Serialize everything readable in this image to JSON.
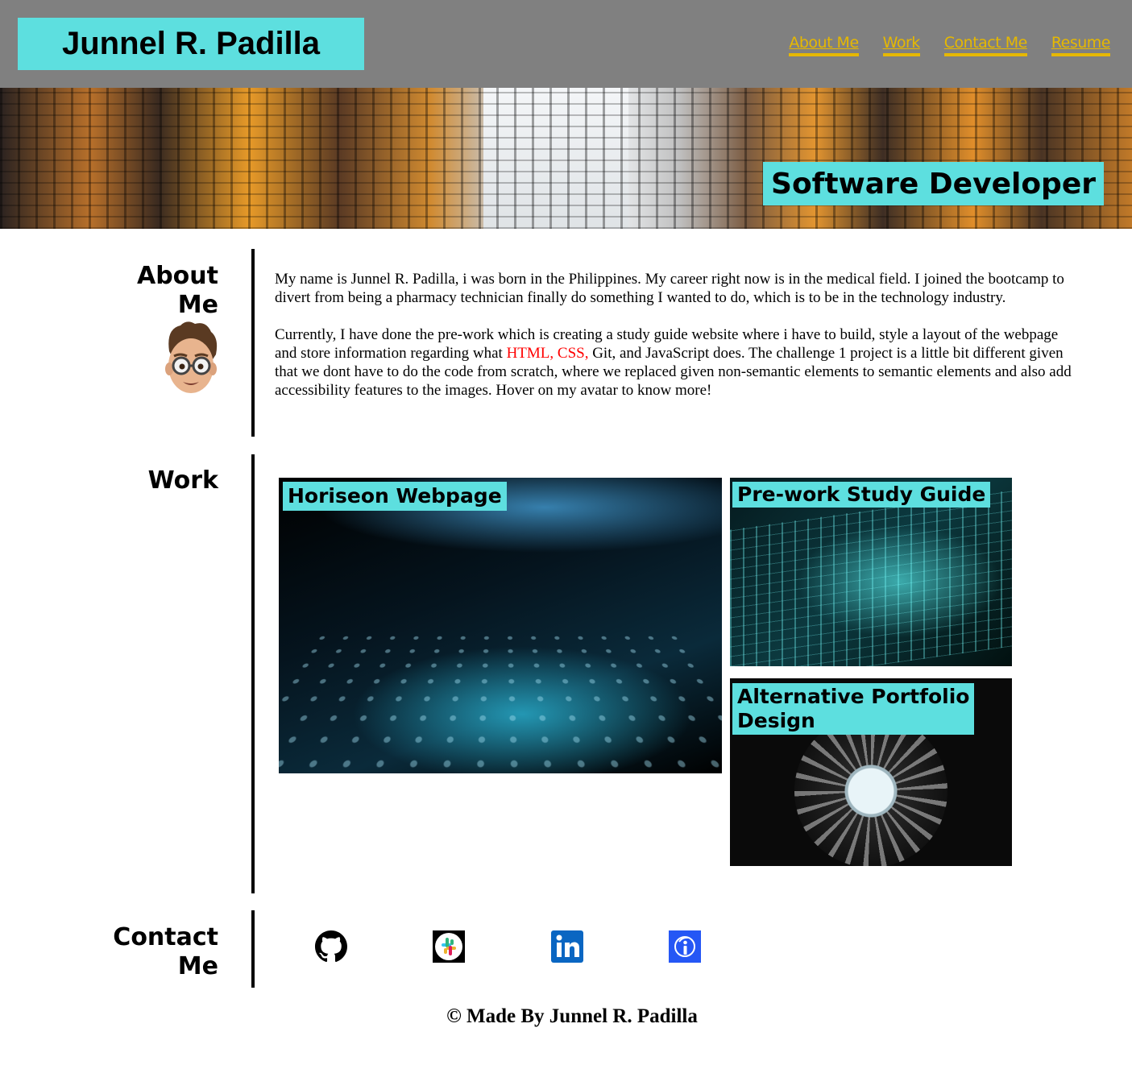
{
  "header": {
    "brand": "Junnel R. Padilla",
    "nav": [
      "About Me",
      "Work",
      "Contact Me",
      "Resume"
    ]
  },
  "hero": {
    "title": "Software Developer"
  },
  "about": {
    "label_line1": "About",
    "label_line2": "Me",
    "paragraph1": "My name is Junnel R. Padilla, i was born in the Philippines. My career right now is in the medical field. I joined the bootcamp to divert from being a pharmacy technician finally do something I wanted to do, which is to be in the technology industry.",
    "paragraph2_before": "Currently, I have done the pre-work which is creating a study guide website where i have to build, style a layout of the webpage and store information regarding what ",
    "paragraph2_highlight": "HTML, CSS,",
    "paragraph2_after": " Git, and JavaScript does. The challenge 1 project is a little bit different given that we dont have to do the code from scratch, where we replaced given non-semantic elements to semantic elements and also add accessibility features to the images. Hover on my avatar to know more!"
  },
  "work": {
    "label": "Work",
    "cards": [
      {
        "title": "Horiseon Webpage"
      },
      {
        "title": "Pre-work Study Guide"
      },
      {
        "title_line1": "Alternative Portfolio",
        "title_line2": "Design"
      }
    ]
  },
  "contact": {
    "label_line1": "Contact",
    "label_line2": "Me",
    "icons": [
      "github-icon",
      "slack-icon",
      "linkedin-icon",
      "indeed-icon"
    ]
  },
  "footer": {
    "text": "© Made By Junnel R. Padilla"
  },
  "colors": {
    "accent": "#5ddfdf",
    "header_bg": "#808080",
    "nav_link": "#e6b800",
    "highlight_text": "#ff0000"
  }
}
